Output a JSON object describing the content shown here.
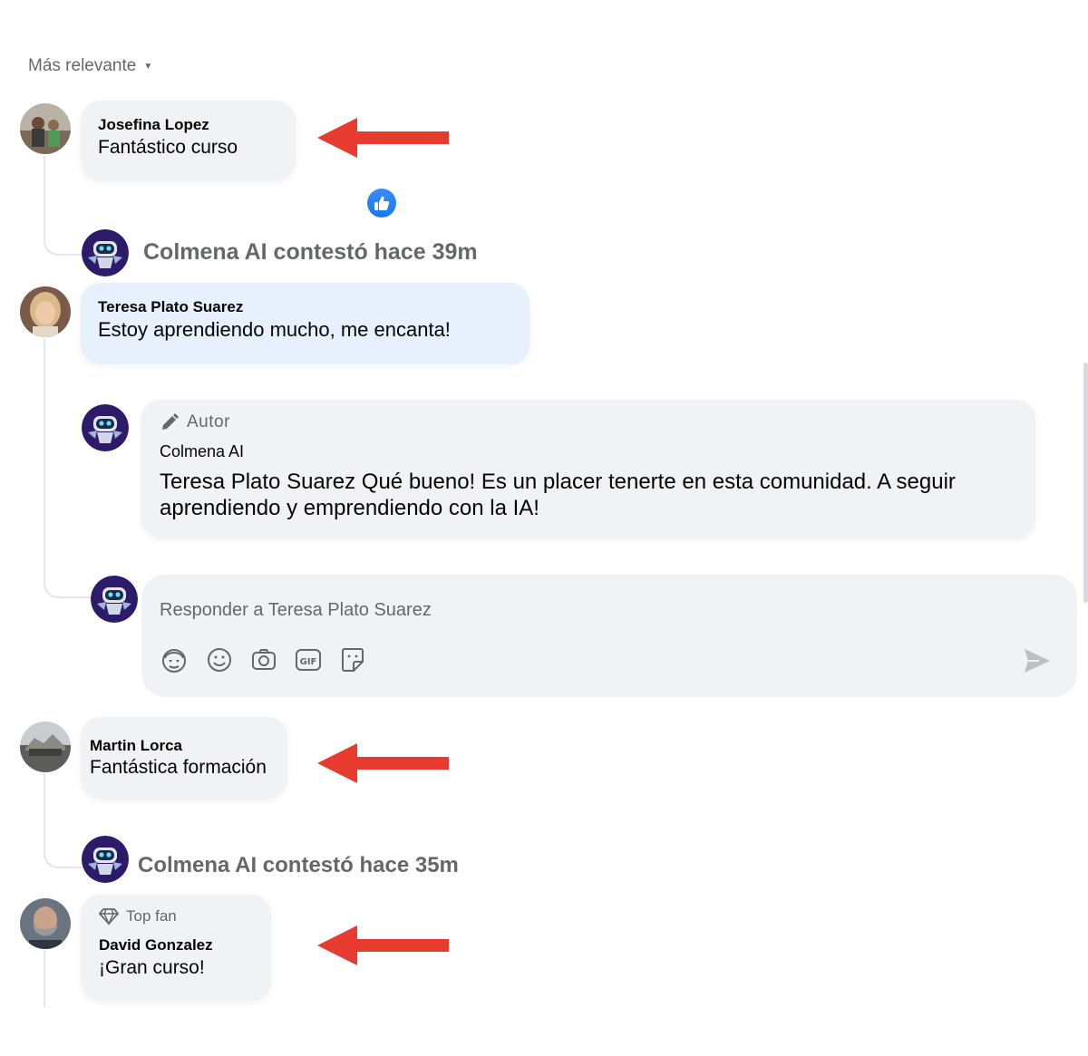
{
  "sort": {
    "label": "Más relevante"
  },
  "comments": [
    {
      "author": "Josefina Lopez",
      "text": "Fantástico curso"
    },
    {
      "author": "Teresa Plato Suarez",
      "text": "Estoy aprendiendo mucho, me encanta!"
    },
    {
      "author": "Martin Lorca",
      "text": "Fantástica formación"
    },
    {
      "badge": "Top fan",
      "author": "David Gonzalez",
      "text": "¡Gran curso!"
    }
  ],
  "reply_summaries": [
    {
      "text": "Colmena AI contestó hace 39m"
    },
    {
      "text": "Colmena AI contestó hace 35m"
    }
  ],
  "reply": {
    "badge": "Autor",
    "author": "Colmena AI",
    "text_line1": "Teresa Plato Suarez Qué bueno! Es un placer tenerte en esta comunidad. A seguir",
    "text_line2": "aprendiendo y emprendiendo con la IA!"
  },
  "composer": {
    "placeholder": "Responder a Teresa Plato Suarez",
    "tools": [
      "avatar-sticker-icon",
      "emoji-icon",
      "camera-icon",
      "gif-icon",
      "sticker-icon"
    ]
  },
  "colors": {
    "arrow": "#e63b2e",
    "like": "#1877f2",
    "bot": "#2d1b69"
  }
}
